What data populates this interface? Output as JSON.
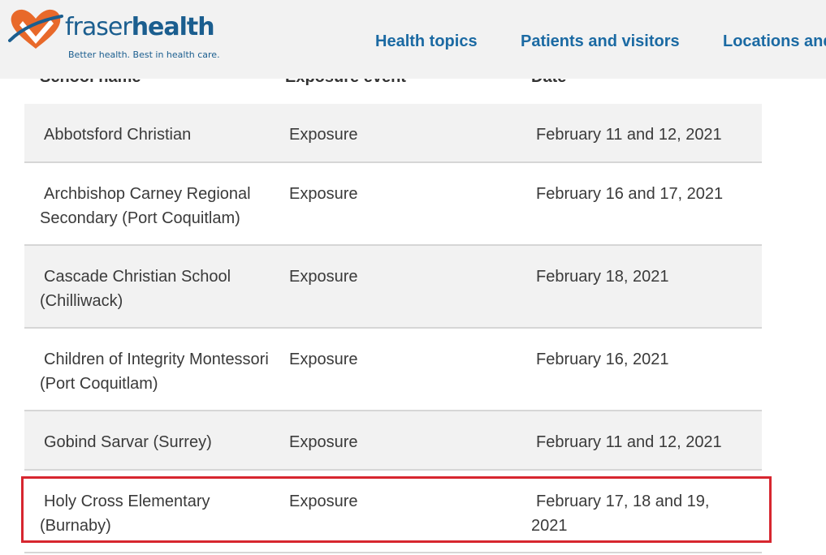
{
  "header": {
    "logo": {
      "wordmark_light": "fraser",
      "wordmark_bold": "health",
      "tagline": "Better health. Best in health care."
    },
    "nav": [
      {
        "label": "Health topics"
      },
      {
        "label": "Patients and visitors"
      },
      {
        "label": "Locations and"
      }
    ]
  },
  "table": {
    "columns": [
      "School name",
      "Exposure event",
      "Date"
    ],
    "rows": [
      {
        "school": "Abbotsford Christian",
        "event": "Exposure",
        "date": "February 11 and 12, 2021"
      },
      {
        "school": "Archbishop Carney Regional Secondary (Port Coquitlam)",
        "event": "Exposure",
        "date": "February 16 and 17, 2021"
      },
      {
        "school": "Cascade Christian School (Chilliwack)",
        "event": "Exposure",
        "date": "February 18, 2021"
      },
      {
        "school": "Children of Integrity Montessori (Port Coquitlam)",
        "event": "Exposure",
        "date": "February 16, 2021"
      },
      {
        "school": "Gobind Sarvar (Surrey)",
        "event": "Exposure",
        "date": "February 11 and 12, 2021"
      },
      {
        "school": "Holy Cross Elementary (Burnaby)",
        "event": "Exposure",
        "date": "February 17, 18 and 19, 2021"
      }
    ]
  },
  "colors": {
    "brand_blue": "#1b5e8f",
    "nav_blue": "#1b6aa3",
    "logo_orange": "#e8692a",
    "highlight_red": "#d7262f",
    "row_shade": "#f2f2f2"
  }
}
